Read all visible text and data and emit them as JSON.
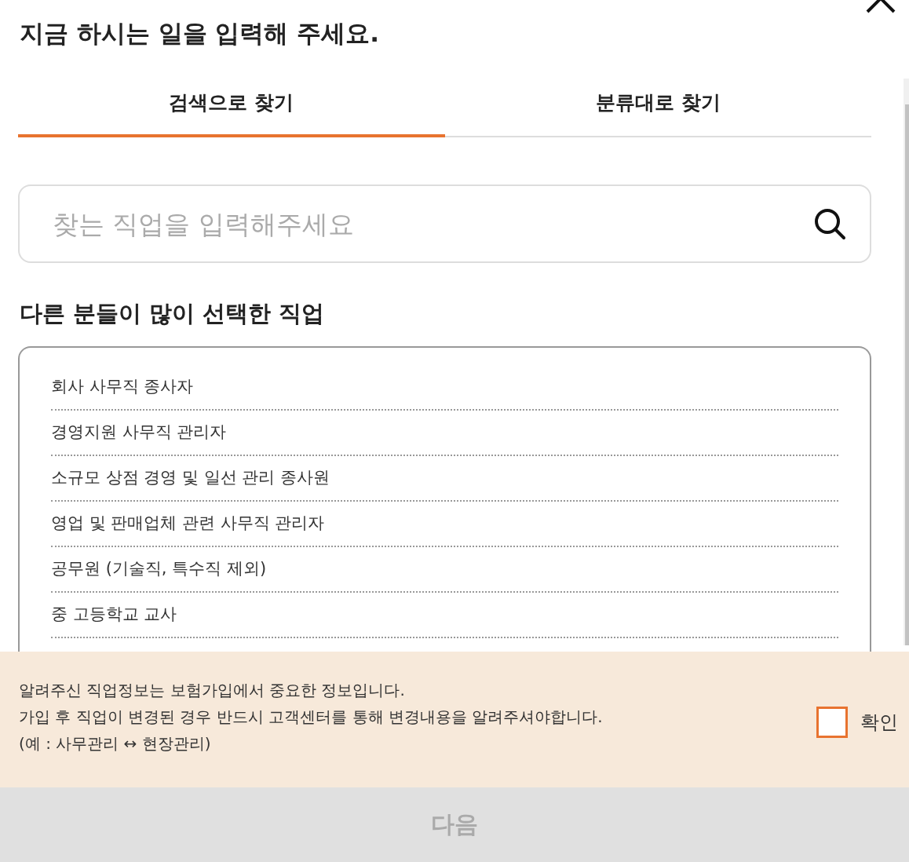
{
  "title": "지금 하시는 일을 입력해 주세요.",
  "tabs": [
    {
      "label": "검색으로 찾기",
      "selected": true
    },
    {
      "label": "분류대로 찾기",
      "selected": false
    }
  ],
  "search": {
    "placeholder": "찾는 직업을 입력해주세요"
  },
  "popular": {
    "heading": "다른 분들이 많이 선택한 직업",
    "items": [
      "회사 사무직 종사자",
      "경영지원 사무직 관리자",
      "소규모 상점 경영 및 일선 관리 종사원",
      "영업 및 판매업체 관련 사무직 관리자",
      "공무원 (기술직, 특수직 제외)",
      "중 고등학교 교사"
    ]
  },
  "notice": {
    "lines": [
      "알려주신 직업정보는 보험가입에서 중요한 정보입니다.",
      "가입 후 직업이 변경된 경우 반드시 고객센터를 통해 변경내용을 알려주셔야합니다.",
      "(예 : 사무관리 ↔ 현장관리)"
    ],
    "confirm": {
      "label": "확인",
      "checked": false
    }
  },
  "next_button": {
    "label": "다음",
    "disabled": true
  }
}
